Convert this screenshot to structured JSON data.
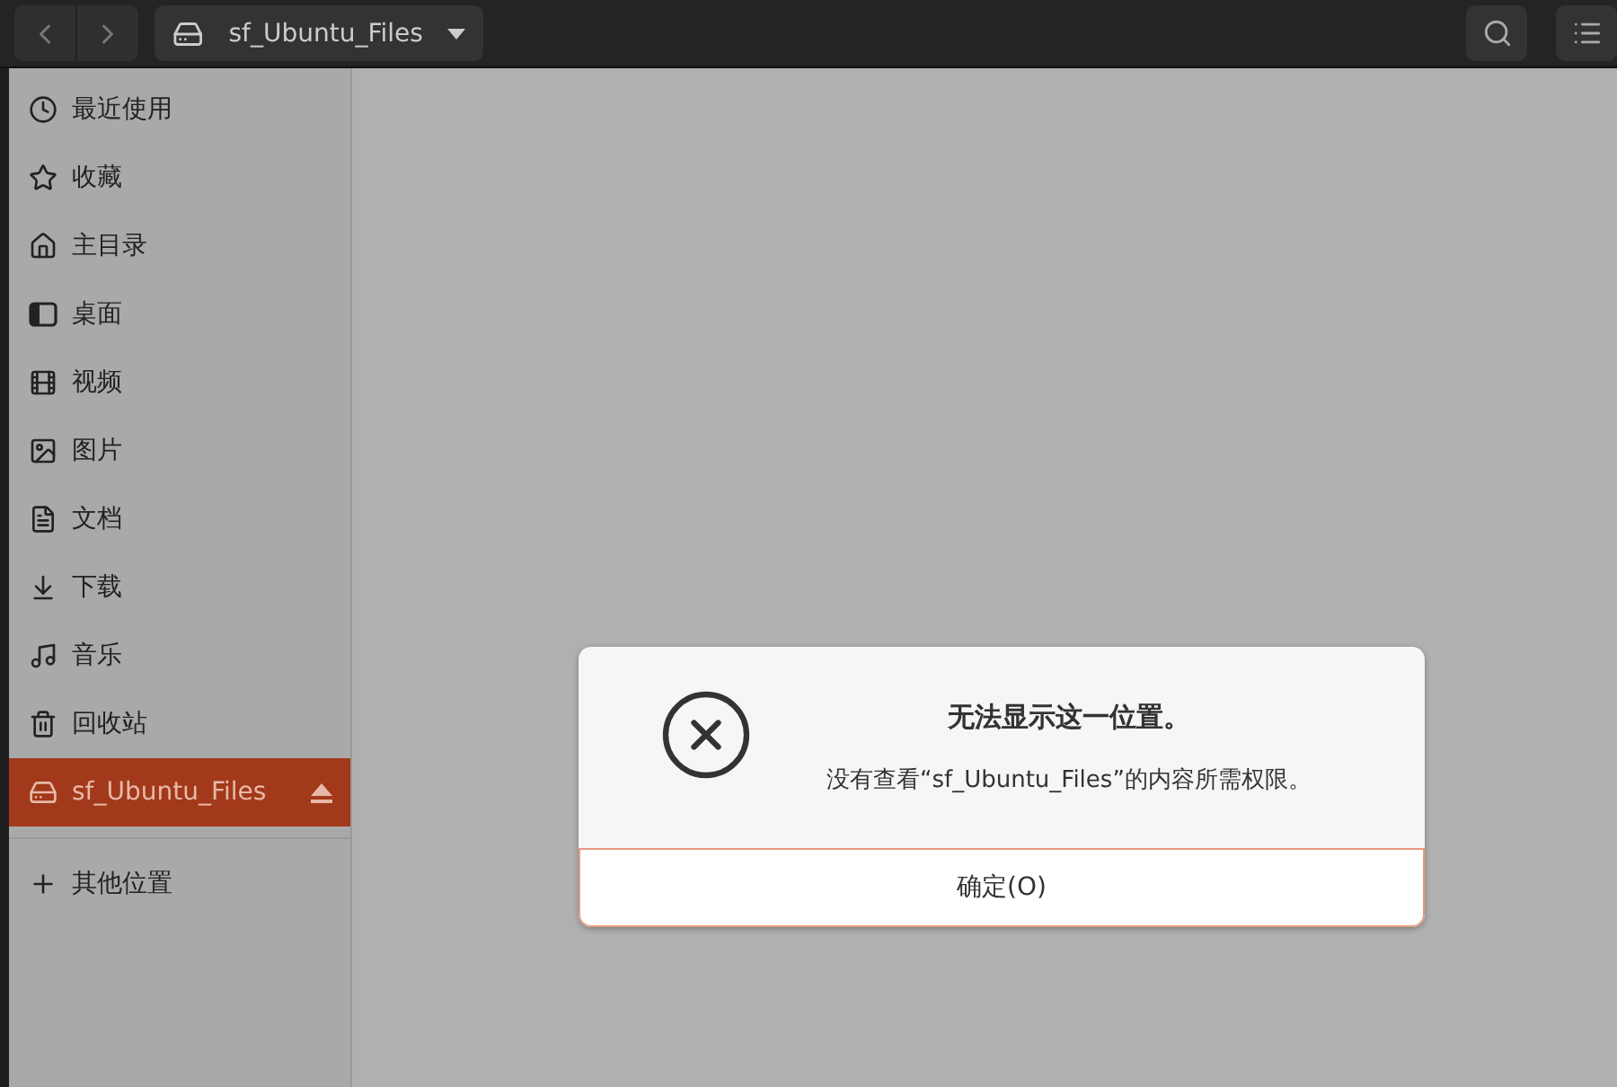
{
  "header": {
    "location": "sf_Ubuntu_Files"
  },
  "sidebar": {
    "items": [
      {
        "label": "最近使用",
        "selected": false
      },
      {
        "label": "收藏",
        "selected": false
      },
      {
        "label": "主目录",
        "selected": false
      },
      {
        "label": "桌面",
        "selected": false
      },
      {
        "label": "视频",
        "selected": false
      },
      {
        "label": "图片",
        "selected": false
      },
      {
        "label": "文档",
        "selected": false
      },
      {
        "label": "下载",
        "selected": false
      },
      {
        "label": "音乐",
        "selected": false
      },
      {
        "label": "回收站",
        "selected": false
      },
      {
        "label": "sf_Ubuntu_Files",
        "selected": true,
        "ejectable": true
      }
    ],
    "other": {
      "label": "其他位置"
    }
  },
  "dialog": {
    "title": "无法显示这一位置。",
    "message": "没有查看“sf_Ubuntu_Files”的内容所需权限。",
    "button": "确定(O)"
  }
}
